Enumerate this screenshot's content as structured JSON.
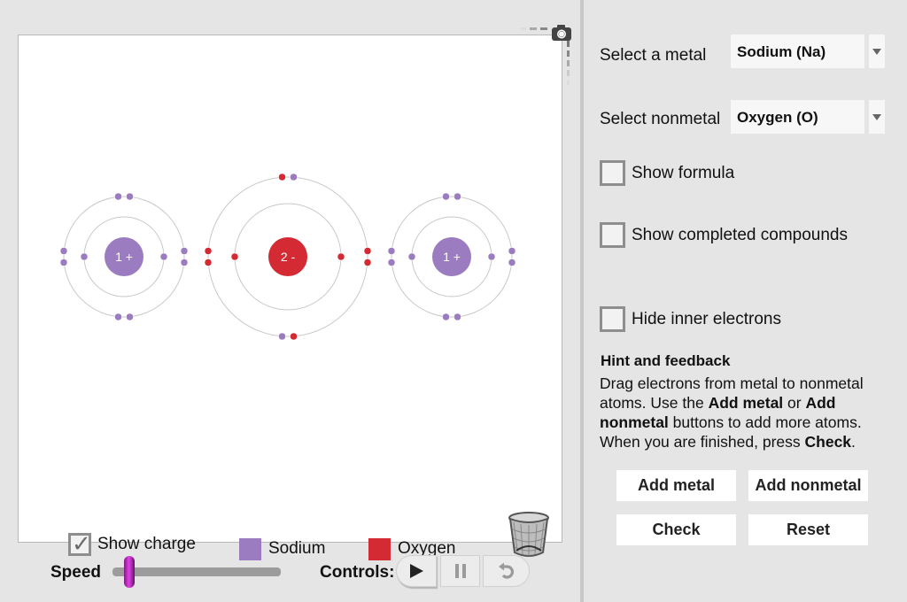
{
  "simulation": {
    "atoms": [
      {
        "element": "Sodium",
        "symbol": "Na",
        "charge_label": "1 +",
        "color": "#9b7cc0",
        "inner_shell_electrons": 2,
        "outer_shell_electrons": [
          {
            "color": "#9b7cc0"
          },
          {
            "color": "#9b7cc0"
          },
          {
            "color": "#9b7cc0"
          },
          {
            "color": "#9b7cc0"
          },
          {
            "color": "#9b7cc0"
          },
          {
            "color": "#9b7cc0"
          },
          {
            "color": "#9b7cc0"
          },
          {
            "color": "#9b7cc0"
          }
        ]
      },
      {
        "element": "Oxygen",
        "symbol": "O",
        "charge_label": "2 -",
        "color": "#d42a33",
        "inner_shell_electrons": 2,
        "outer_shell_electrons": [
          {
            "color": "#d42a33"
          },
          {
            "color": "#9b7cc0"
          },
          {
            "color": "#d42a33"
          },
          {
            "color": "#d42a33"
          },
          {
            "color": "#9b7cc0"
          },
          {
            "color": "#d42a33"
          },
          {
            "color": "#d42a33"
          },
          {
            "color": "#d42a33"
          }
        ]
      },
      {
        "element": "Sodium",
        "symbol": "Na",
        "charge_label": "1 +",
        "color": "#9b7cc0",
        "inner_shell_electrons": 2,
        "outer_shell_electrons": [
          {
            "color": "#9b7cc0"
          },
          {
            "color": "#9b7cc0"
          },
          {
            "color": "#9b7cc0"
          },
          {
            "color": "#9b7cc0"
          },
          {
            "color": "#9b7cc0"
          },
          {
            "color": "#9b7cc0"
          },
          {
            "color": "#9b7cc0"
          },
          {
            "color": "#9b7cc0"
          }
        ]
      }
    ],
    "show_charge": {
      "label": "Show charge",
      "checked": true
    },
    "legend": [
      {
        "label": "Sodium",
        "color": "#9b7cc0"
      },
      {
        "label": "Oxygen",
        "color": "#d42a33"
      }
    ],
    "icons": {
      "camera": "camera-icon",
      "trash": "trash-icon"
    }
  },
  "controls": {
    "speed_label": "Speed",
    "speed_value": 0.1,
    "controls_label": "Controls:",
    "buttons": [
      "play",
      "pause",
      "reset"
    ]
  },
  "panel": {
    "metal": {
      "label": "Select a metal",
      "value": "Sodium (Na)"
    },
    "nonmetal": {
      "label": "Select nonmetal",
      "value": "Oxygen (O)"
    },
    "options": [
      {
        "label": "Show formula",
        "checked": false
      },
      {
        "label": "Show completed compounds",
        "checked": false
      },
      {
        "label": "Hide inner electrons",
        "checked": false
      }
    ],
    "hint": {
      "title": "Hint and feedback",
      "text_parts": [
        {
          "text": "Drag electrons from metal to nonmetal atoms. Use the ",
          "bold": false
        },
        {
          "text": "Add metal",
          "bold": true
        },
        {
          "text": " or ",
          "bold": false
        },
        {
          "text": "Add nonmetal",
          "bold": true
        },
        {
          "text": " buttons to add more atoms. When you are finished, press ",
          "bold": false
        },
        {
          "text": "Check",
          "bold": true
        },
        {
          "text": ".",
          "bold": false
        }
      ]
    },
    "buttons": {
      "add_metal": "Add metal",
      "add_nonmetal": "Add nonmetal",
      "check": "Check",
      "reset": "Reset"
    }
  }
}
